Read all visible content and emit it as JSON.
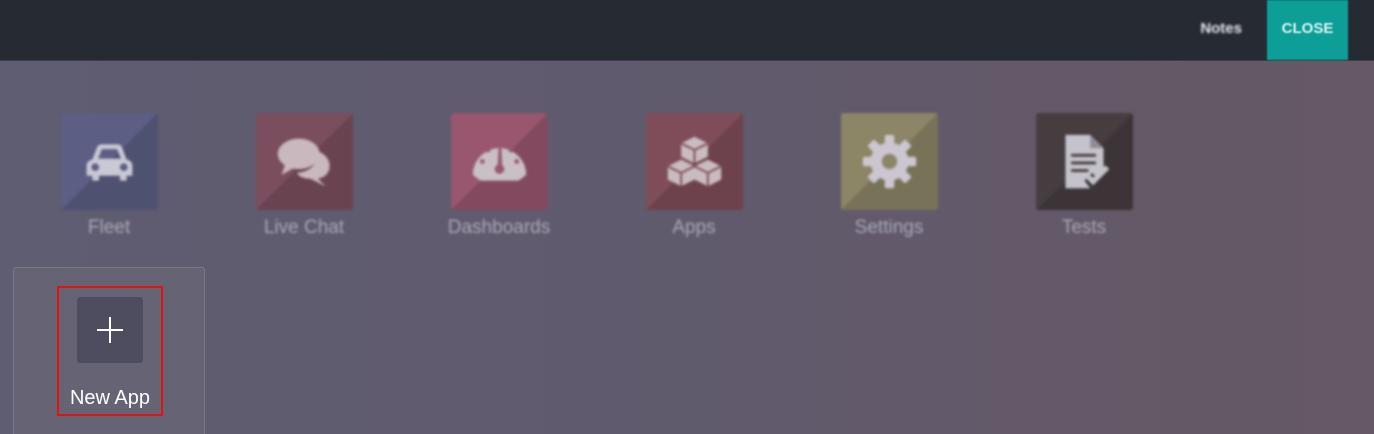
{
  "topbar": {
    "notes_label": "Notes",
    "close_label": "CLOSE"
  },
  "apps": [
    {
      "label": "Fleet",
      "icon": "car-icon",
      "color": "#5c5e84"
    },
    {
      "label": "Live Chat",
      "icon": "chat-bubbles-icon",
      "color": "#7b4e5e"
    },
    {
      "label": "Dashboards",
      "icon": "speedometer-icon",
      "color": "#99566f"
    },
    {
      "label": "Apps",
      "icon": "cubes-icon",
      "color": "#7f4d59"
    },
    {
      "label": "Settings",
      "icon": "gear-icon",
      "color": "#8c8566"
    },
    {
      "label": "Tests",
      "icon": "document-check-icon",
      "color": "#463d40"
    }
  ],
  "new_app": {
    "label": "New App",
    "icon": "plus-icon"
  },
  "colors": {
    "topbar_bg": "#252a33",
    "close_bg": "#0e9e98",
    "highlight_border": "#e01313"
  }
}
